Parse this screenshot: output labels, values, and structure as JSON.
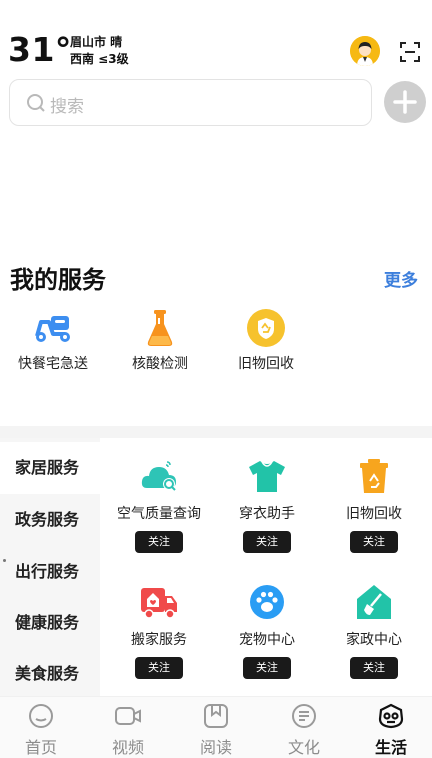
{
  "header": {
    "temperature": "31°",
    "city_weather": "眉山市 晴",
    "wind": "西南 ≤3级",
    "avatar_icon": "avatar-icon",
    "scan_icon": "scan-icon"
  },
  "search": {
    "placeholder": "搜索",
    "icon": "search-icon"
  },
  "add_icon": "plus-icon",
  "my_services": {
    "title": "我的服务",
    "more": "更多",
    "items": [
      {
        "label": "快餐宅急送",
        "icon": "scooter-icon",
        "color": "#3d8ef0"
      },
      {
        "label": "核酸检测",
        "icon": "flask-icon",
        "color": "#f7931e"
      },
      {
        "label": "旧物回收",
        "icon": "recycle-badge-icon",
        "color": "#f6c22d"
      }
    ]
  },
  "categories": [
    {
      "label": "家居服务",
      "active": true
    },
    {
      "label": "政务服务"
    },
    {
      "label": "出行服务"
    },
    {
      "label": "健康服务"
    },
    {
      "label": "美食服务"
    }
  ],
  "category_items": [
    {
      "label": "空气质量查询",
      "icon": "air-cloud-icon",
      "color": "#2ec4b6",
      "action": "关注"
    },
    {
      "label": "穿衣助手",
      "icon": "tshirt-icon",
      "color": "#22c3a8",
      "action": "关注"
    },
    {
      "label": "旧物回收",
      "icon": "recycle-bin-icon",
      "color": "#f7a51e",
      "action": "关注"
    },
    {
      "label": "搬家服务",
      "icon": "moving-truck-icon",
      "color": "#f04a4a",
      "action": "关注"
    },
    {
      "label": "宠物中心",
      "icon": "paw-icon",
      "color": "#2a9df4",
      "action": "关注"
    },
    {
      "label": "家政中心",
      "icon": "house-broom-icon",
      "color": "#22c3a8",
      "action": "关注"
    }
  ],
  "tabs": [
    {
      "label": "首页",
      "icon": "home-face-icon"
    },
    {
      "label": "视频",
      "icon": "video-icon"
    },
    {
      "label": "阅读",
      "icon": "book-icon"
    },
    {
      "label": "文化",
      "icon": "document-icon"
    },
    {
      "label": "生活",
      "icon": "life-icon",
      "active": true
    }
  ]
}
